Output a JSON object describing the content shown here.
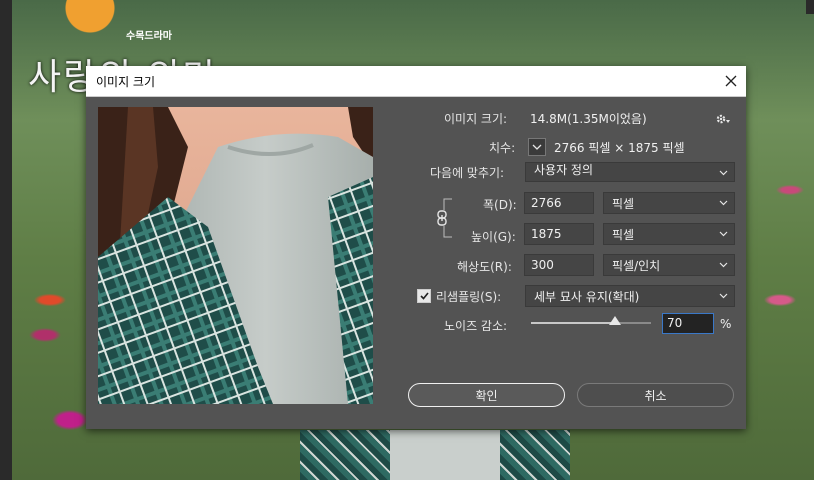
{
  "background": {
    "watermark": "사랑의 의미",
    "logo_text": "수목드라마"
  },
  "dialog": {
    "title": "이미지 크기",
    "image_size_label": "이미지 크기:",
    "image_size_value": "14.8M(1.35M이었음)",
    "dimensions_label": "치수:",
    "dimensions_value": "2766 픽셀 × 1875 픽셀",
    "fit_to_label": "다음에 맞추기:",
    "fit_to_value": "사용자 정의",
    "width_label": "폭(D):",
    "width_value": "2766",
    "width_unit": "픽셀",
    "height_label": "높이(G):",
    "height_value": "1875",
    "height_unit": "픽셀",
    "resolution_label": "해상도(R):",
    "resolution_value": "300",
    "resolution_unit": "픽셀/인치",
    "resample_label": "리샘플링(S):",
    "resample_checked": true,
    "resample_value": "세부 묘사 유지(확대)",
    "noise_label": "노이즈 감소:",
    "noise_value": "70",
    "noise_unit": "%",
    "noise_fraction": 0.7,
    "ok_label": "확인",
    "cancel_label": "취소"
  },
  "icons": {
    "close": "close-icon",
    "settings": "gear-icon",
    "dimensions_toggle": "chevron-down-icon",
    "constrain": "chain-link-icon",
    "dropdown": "chevron-down-icon",
    "check": "checkmark-icon"
  }
}
